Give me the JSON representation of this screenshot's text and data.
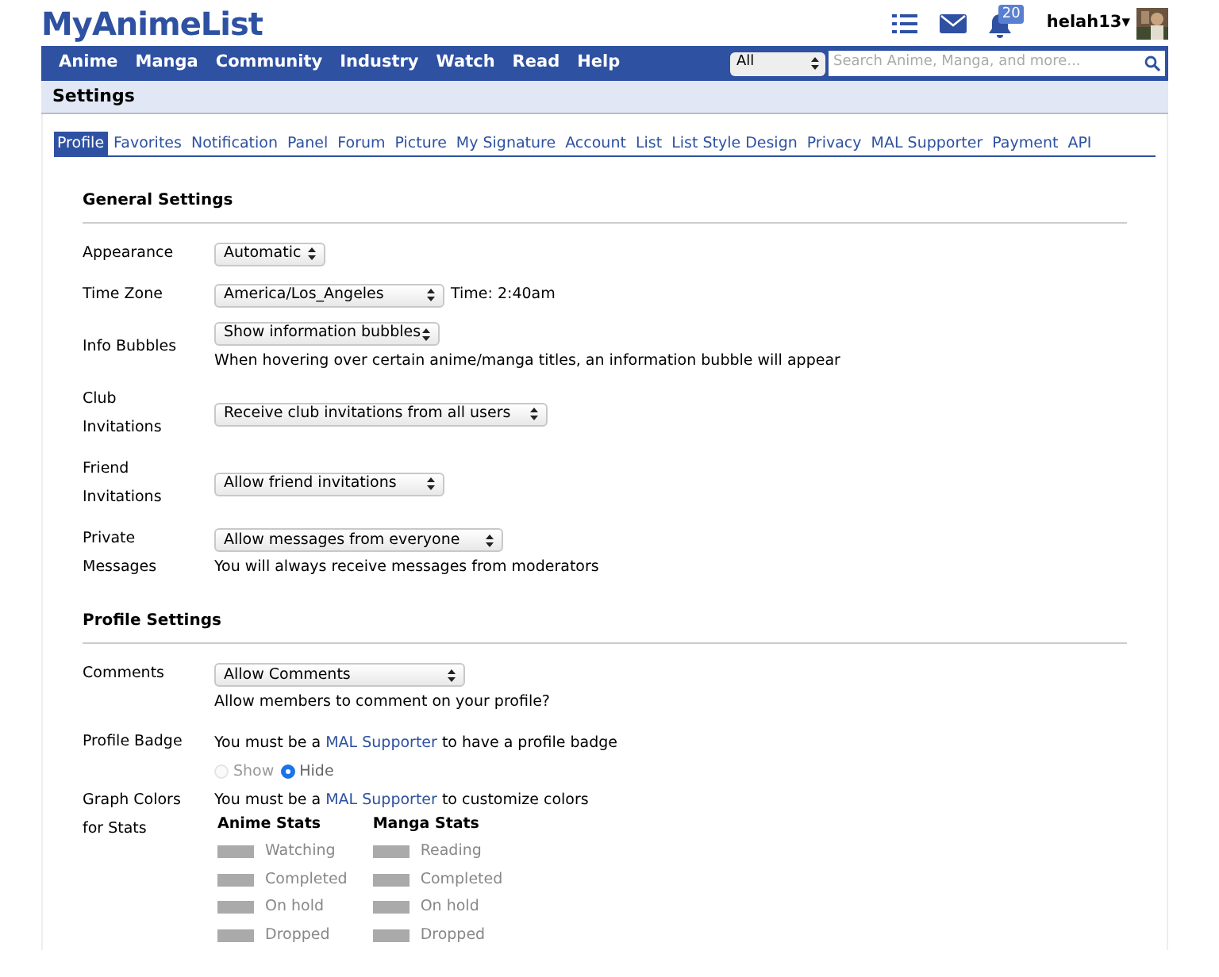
{
  "header": {
    "logo": "MyAnimeList",
    "notification_count": "20",
    "username": "helah13",
    "caret": "▾"
  },
  "nav": {
    "items": [
      "Anime",
      "Manga",
      "Community",
      "Industry",
      "Watch",
      "Read",
      "Help"
    ],
    "search_scope": "All",
    "search": {
      "placeholder": "Search Anime, Manga, and more..."
    }
  },
  "page_title": "Settings",
  "tabs": [
    {
      "label": "Profile",
      "selected": true
    },
    {
      "label": "Favorites",
      "selected": false
    },
    {
      "label": "Notification",
      "selected": false
    },
    {
      "label": "Panel",
      "selected": false
    },
    {
      "label": "Forum",
      "selected": false
    },
    {
      "label": "Picture",
      "selected": false
    },
    {
      "label": "My Signature",
      "selected": false
    },
    {
      "label": "Account",
      "selected": false
    },
    {
      "label": "List",
      "selected": false
    },
    {
      "label": "List Style Design",
      "selected": false
    },
    {
      "label": "Privacy",
      "selected": false
    },
    {
      "label": "MAL Supporter",
      "selected": false
    },
    {
      "label": "Payment",
      "selected": false
    },
    {
      "label": "API",
      "selected": false
    }
  ],
  "general_settings": {
    "title": "General Settings",
    "rows": [
      {
        "label": [
          "Appearance"
        ],
        "select": "Automatic"
      },
      {
        "label": [
          "Time Zone"
        ],
        "select": "America/Los_Angeles",
        "suffix": "Time: 2:40am"
      },
      {
        "label": [
          "Info Bubbles"
        ],
        "select": "Show information bubbles",
        "note": "When hovering over certain anime/manga titles, an information bubble will appear"
      },
      {
        "label": [
          "Club",
          "Invitations"
        ],
        "select": "Receive club invitations from all users"
      },
      {
        "label": [
          "Friend",
          "Invitations"
        ],
        "select": "Allow friend invitations"
      },
      {
        "label": [
          "Private",
          "Messages"
        ],
        "select": "Allow messages from everyone",
        "note": "You will always receive messages from moderators"
      }
    ]
  },
  "profile_settings": {
    "title": "Profile Settings",
    "comments": {
      "label": [
        "Comments"
      ],
      "select": "Allow Comments",
      "note": "Allow members to comment on your profile?"
    },
    "badge": {
      "label": [
        "Profile Badge"
      ],
      "before": "You must be a ",
      "link": "MAL Supporter",
      "after": " to have a profile badge",
      "options": [
        {
          "label": "Show",
          "selected": false,
          "disabled": true
        },
        {
          "label": "Hide",
          "selected": true,
          "disabled": false
        }
      ]
    },
    "graph": {
      "label": [
        "Graph Colors",
        "for Stats"
      ],
      "before": "You must be a ",
      "link": "MAL Supporter",
      "after": " to customize colors",
      "disabled": true,
      "columns": [
        {
          "title": "Anime Stats",
          "items": [
            "Watching",
            "Completed",
            "On hold",
            "Dropped"
          ]
        },
        {
          "title": "Manga Stats",
          "items": [
            "Reading",
            "Completed",
            "On hold",
            "Dropped"
          ]
        }
      ]
    }
  }
}
